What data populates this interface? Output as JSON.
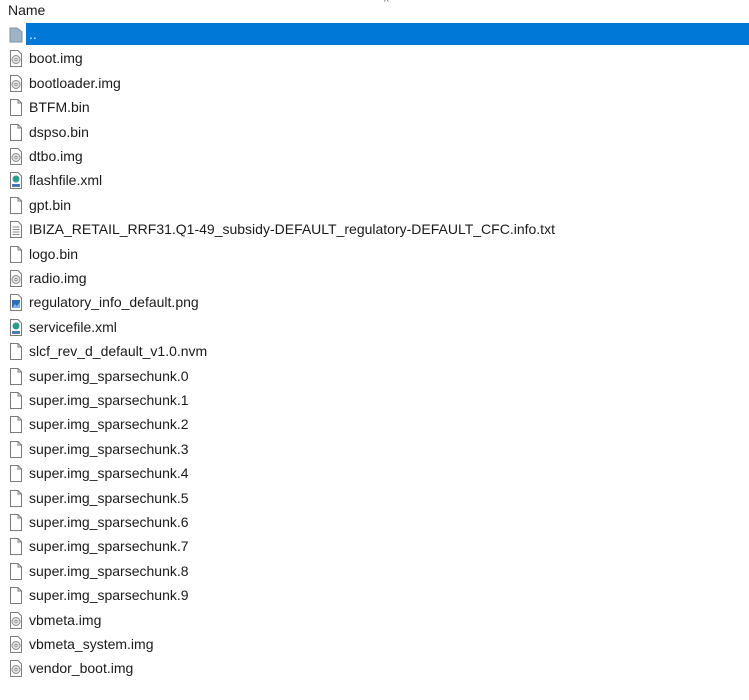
{
  "columns": {
    "name_header": "Name"
  },
  "files": [
    {
      "name": "..",
      "icon": "folder-up-icon",
      "selected": true
    },
    {
      "name": "boot.img",
      "icon": "disc-image-icon"
    },
    {
      "name": "bootloader.img",
      "icon": "disc-image-icon"
    },
    {
      "name": "BTFM.bin",
      "icon": "blank-file-icon"
    },
    {
      "name": "dspso.bin",
      "icon": "blank-file-icon"
    },
    {
      "name": "dtbo.img",
      "icon": "disc-image-icon"
    },
    {
      "name": "flashfile.xml",
      "icon": "xml-file-icon"
    },
    {
      "name": "gpt.bin",
      "icon": "blank-file-icon"
    },
    {
      "name": "IBIZA_RETAIL_RRF31.Q1-49_subsidy-DEFAULT_regulatory-DEFAULT_CFC.info.txt",
      "icon": "text-file-icon"
    },
    {
      "name": "logo.bin",
      "icon": "blank-file-icon"
    },
    {
      "name": "radio.img",
      "icon": "disc-image-icon"
    },
    {
      "name": "regulatory_info_default.png",
      "icon": "image-file-icon"
    },
    {
      "name": "servicefile.xml",
      "icon": "xml-file-icon"
    },
    {
      "name": "slcf_rev_d_default_v1.0.nvm",
      "icon": "blank-file-icon"
    },
    {
      "name": "super.img_sparsechunk.0",
      "icon": "blank-file-icon"
    },
    {
      "name": "super.img_sparsechunk.1",
      "icon": "blank-file-icon"
    },
    {
      "name": "super.img_sparsechunk.2",
      "icon": "blank-file-icon"
    },
    {
      "name": "super.img_sparsechunk.3",
      "icon": "blank-file-icon"
    },
    {
      "name": "super.img_sparsechunk.4",
      "icon": "blank-file-icon"
    },
    {
      "name": "super.img_sparsechunk.5",
      "icon": "blank-file-icon"
    },
    {
      "name": "super.img_sparsechunk.6",
      "icon": "blank-file-icon"
    },
    {
      "name": "super.img_sparsechunk.7",
      "icon": "blank-file-icon"
    },
    {
      "name": "super.img_sparsechunk.8",
      "icon": "blank-file-icon"
    },
    {
      "name": "super.img_sparsechunk.9",
      "icon": "blank-file-icon"
    },
    {
      "name": "vbmeta.img",
      "icon": "disc-image-icon"
    },
    {
      "name": "vbmeta_system.img",
      "icon": "disc-image-icon"
    },
    {
      "name": "vendor_boot.img",
      "icon": "disc-image-icon"
    }
  ],
  "colors": {
    "selection": "#0078d7"
  }
}
